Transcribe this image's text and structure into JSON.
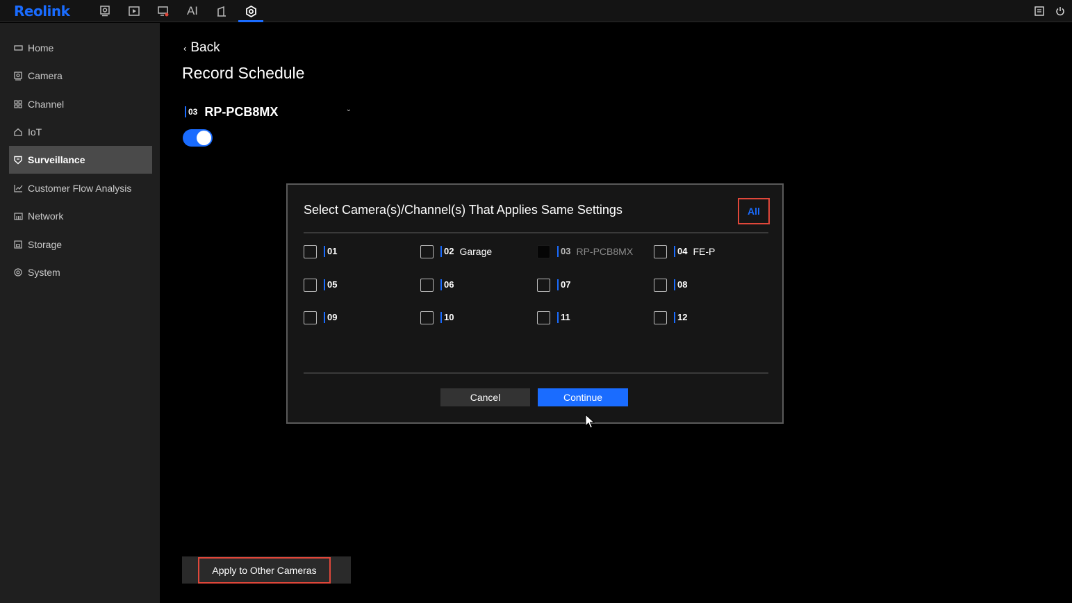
{
  "app": {
    "logo": "Reolink"
  },
  "topnav": {
    "items": [
      {
        "icon": "camera-icon"
      },
      {
        "icon": "playback-icon"
      },
      {
        "icon": "alarm-icon"
      },
      {
        "icon": "ai-icon",
        "label": "AI"
      },
      {
        "icon": "door-icon"
      },
      {
        "icon": "settings-icon",
        "active": true
      }
    ],
    "right": [
      "notes-icon",
      "power-icon"
    ]
  },
  "sidebar": {
    "items": [
      {
        "label": "Home",
        "icon": "home-icon"
      },
      {
        "label": "Camera",
        "icon": "camera-icon"
      },
      {
        "label": "Channel",
        "icon": "channel-icon"
      },
      {
        "label": "IoT",
        "icon": "iot-icon"
      },
      {
        "label": "Surveillance",
        "icon": "shield-icon",
        "active": true
      },
      {
        "label": "Customer Flow Analysis",
        "icon": "chart-icon"
      },
      {
        "label": "Network",
        "icon": "network-icon"
      },
      {
        "label": "Storage",
        "icon": "storage-icon"
      },
      {
        "label": "System",
        "icon": "system-icon"
      }
    ]
  },
  "main": {
    "back_label": "Back",
    "title": "Record Schedule",
    "channel": {
      "number": "03",
      "name": "RP-PCB8MX"
    },
    "toggle_on": true,
    "apply_label": "Apply to Other Cameras"
  },
  "dialog": {
    "title": "Select Camera(s)/Channel(s) That Applies Same Settings",
    "all_label": "All",
    "channels": [
      {
        "num": "01",
        "name": "",
        "disabled": false
      },
      {
        "num": "02",
        "name": "Garage",
        "disabled": false
      },
      {
        "num": "03",
        "name": "RP-PCB8MX",
        "disabled": true
      },
      {
        "num": "04",
        "name": "FE-P",
        "disabled": false
      },
      {
        "num": "05",
        "name": "",
        "disabled": false
      },
      {
        "num": "06",
        "name": "",
        "disabled": false
      },
      {
        "num": "07",
        "name": "",
        "disabled": false
      },
      {
        "num": "08",
        "name": "",
        "disabled": false
      },
      {
        "num": "09",
        "name": "",
        "disabled": false
      },
      {
        "num": "10",
        "name": "",
        "disabled": false
      },
      {
        "num": "11",
        "name": "",
        "disabled": false
      },
      {
        "num": "12",
        "name": "",
        "disabled": false
      }
    ],
    "cancel_label": "Cancel",
    "continue_label": "Continue"
  },
  "colors": {
    "accent": "#1a6cff",
    "highlight": "#e0473a"
  }
}
